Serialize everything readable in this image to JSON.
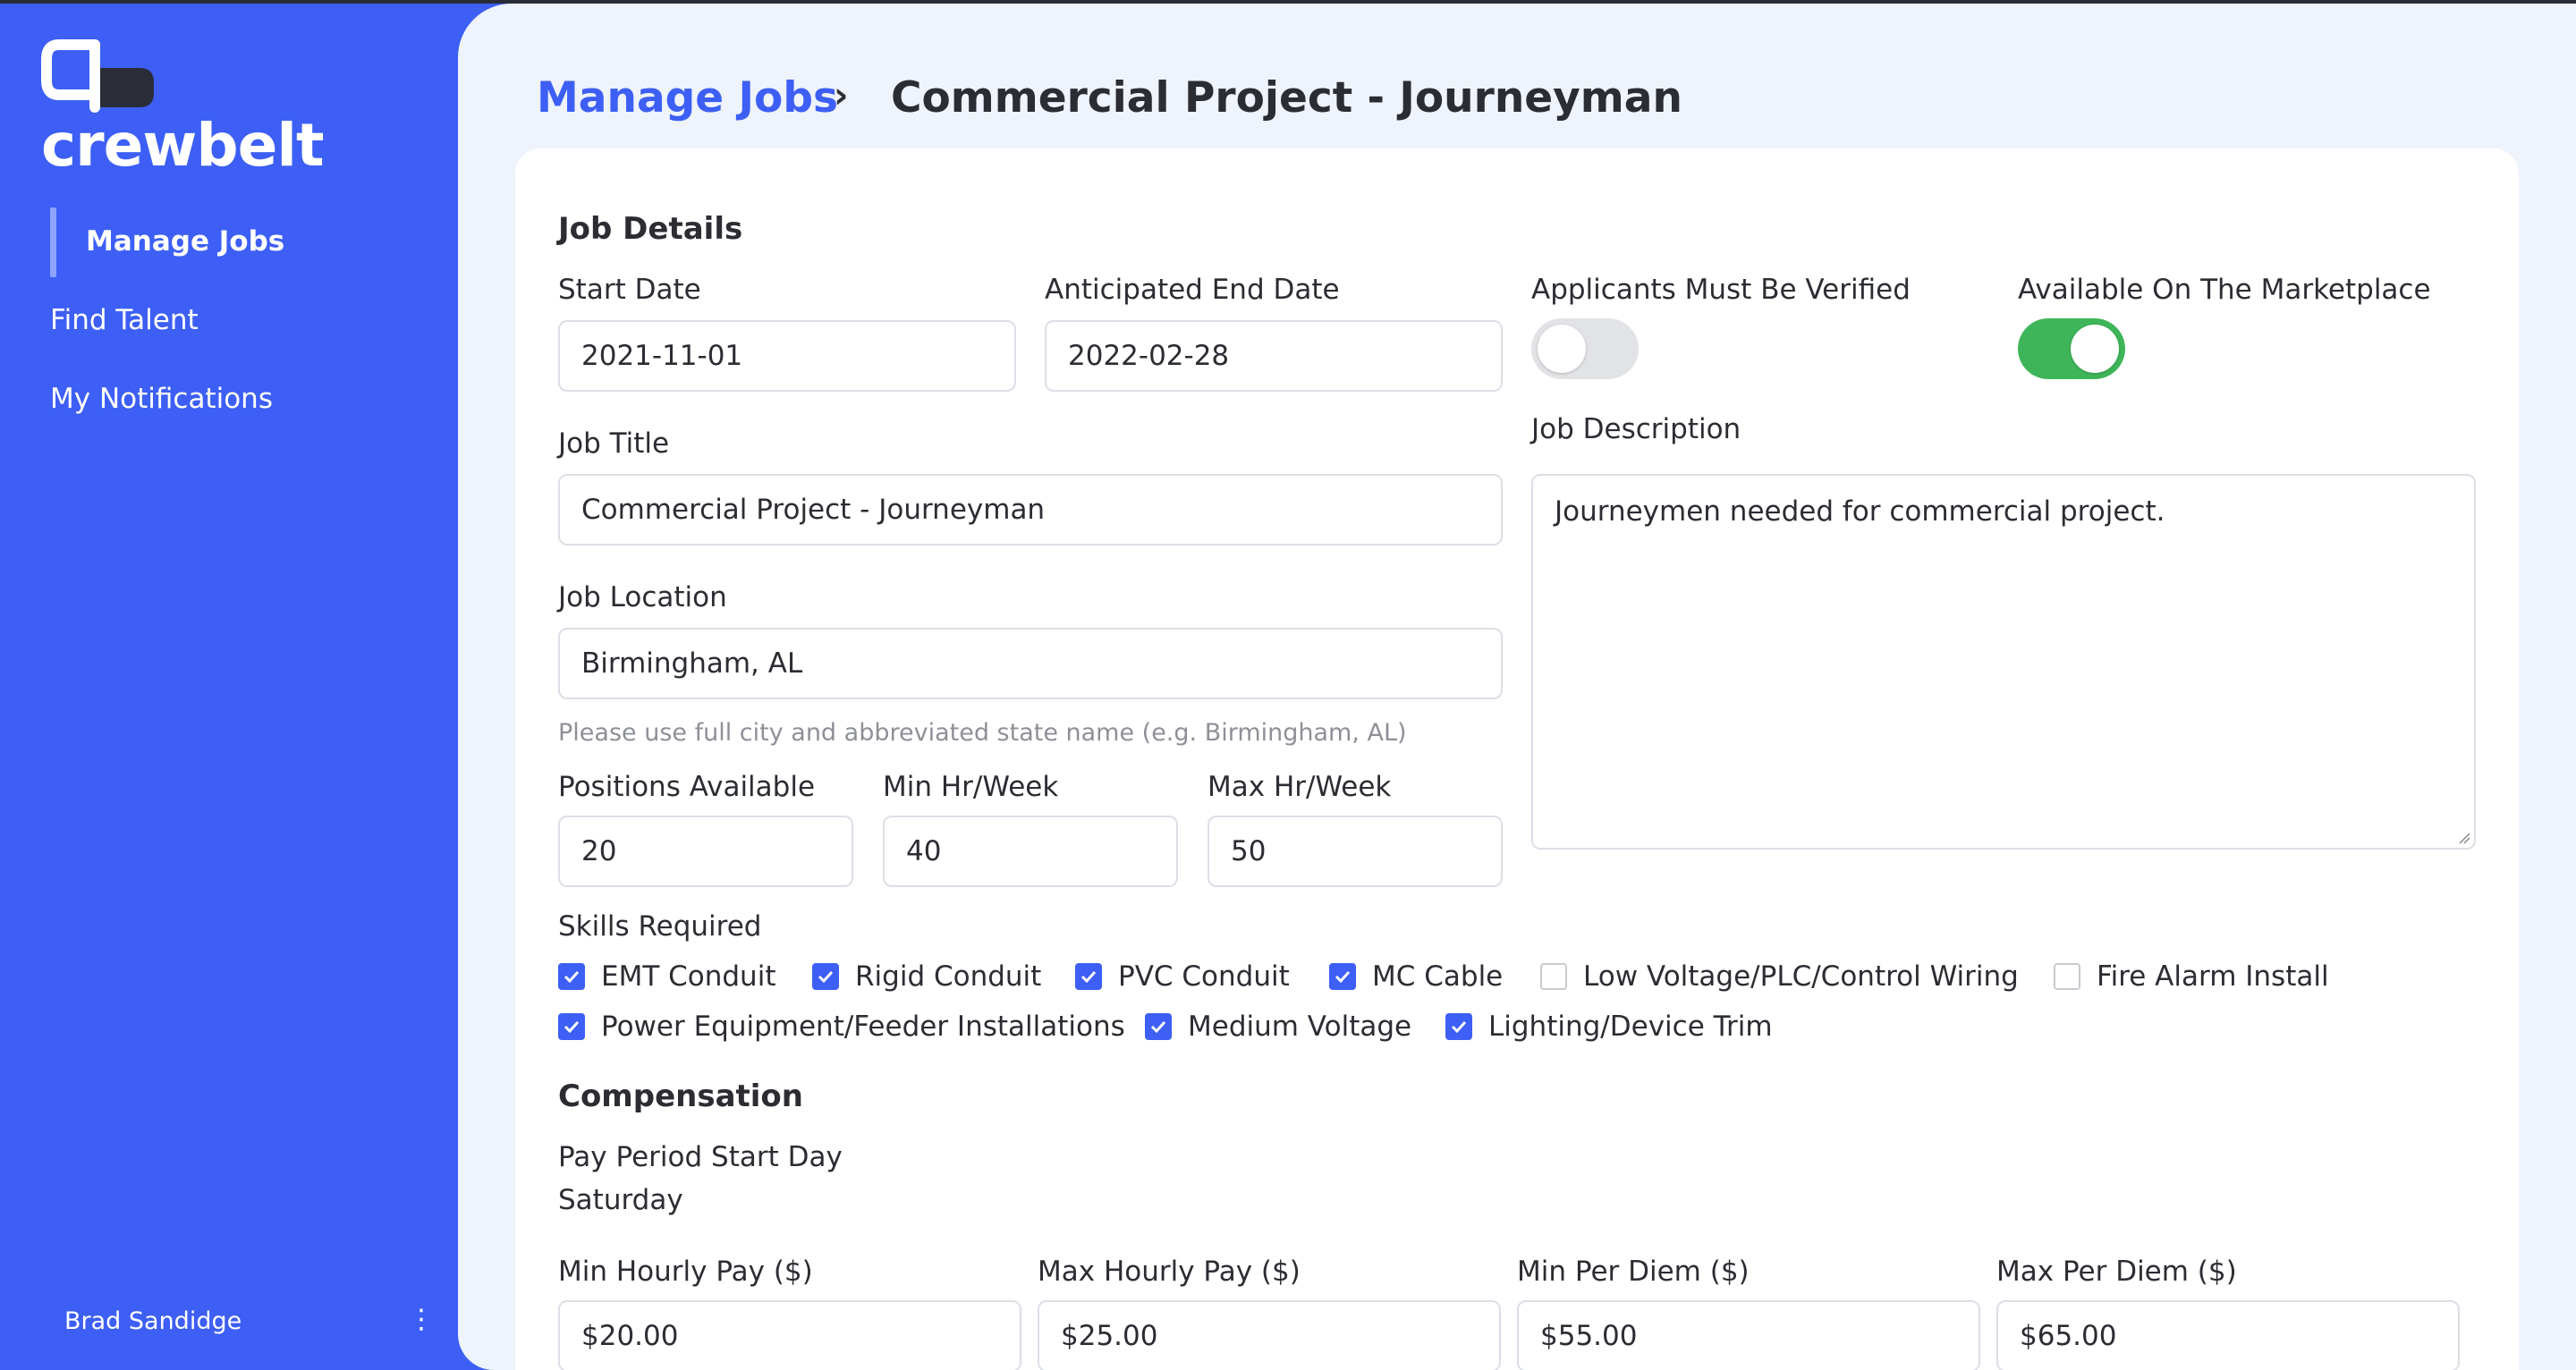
{
  "app": {
    "name": "crewbelt"
  },
  "sidebar": {
    "items": [
      {
        "label": "Manage Jobs",
        "active": true
      },
      {
        "label": "Find Talent",
        "active": false
      },
      {
        "label": "My Notifications",
        "active": false
      }
    ],
    "user_name": "Brad Sandidge",
    "more_icon": "more-vertical-icon"
  },
  "breadcrumb": {
    "parent": "Manage Jobs",
    "separator": "›",
    "current": "Commercial Project - Journeyman"
  },
  "job_details": {
    "title": "Job Details",
    "start_date": {
      "label": "Start Date",
      "value": "2021-11-01"
    },
    "end_date": {
      "label": "Anticipated End Date",
      "value": "2022-02-28"
    },
    "verified": {
      "label": "Applicants Must Be Verified",
      "on": false
    },
    "marketplace": {
      "label": "Available On The Marketplace",
      "on": true
    },
    "job_title": {
      "label": "Job Title",
      "value": "Commercial Project - Journeyman"
    },
    "job_location": {
      "label": "Job Location",
      "value": "Birmingham, AL",
      "hint": "Please use full city and abbreviated state name (e.g. Birmingham, AL)"
    },
    "job_description": {
      "label": "Job Description",
      "value": "Journeymen needed for commercial project."
    },
    "positions": {
      "label": "Positions Available",
      "value": "20"
    },
    "min_hours": {
      "label": "Min Hr/Week",
      "value": "40"
    },
    "max_hours": {
      "label": "Max Hr/Week",
      "value": "50"
    },
    "skills": {
      "label": "Skills Required",
      "items": [
        {
          "label": "EMT Conduit",
          "checked": true
        },
        {
          "label": "Rigid Conduit",
          "checked": true
        },
        {
          "label": "PVC Conduit",
          "checked": true
        },
        {
          "label": "MC Cable",
          "checked": true
        },
        {
          "label": "Low Voltage/PLC/Control Wiring",
          "checked": false
        },
        {
          "label": "Fire Alarm Install",
          "checked": false
        },
        {
          "label": "Power Equipment/Feeder Installations",
          "checked": true
        },
        {
          "label": "Medium Voltage",
          "checked": true
        },
        {
          "label": "Lighting/Device Trim",
          "checked": true
        }
      ]
    }
  },
  "compensation": {
    "title": "Compensation",
    "pay_period": {
      "label": "Pay Period Start Day",
      "value": "Saturday"
    },
    "min_hourly": {
      "label": "Min Hourly Pay ($)",
      "value": "$20.00"
    },
    "max_hourly": {
      "label": "Max Hourly Pay ($)",
      "value": "$25.00"
    },
    "min_per_diem": {
      "label": "Min Per Diem ($)",
      "value": "$55.00"
    },
    "max_per_diem": {
      "label": "Max Per Diem ($)",
      "value": "$65.00"
    }
  },
  "colors": {
    "brand": "#3d5ff5",
    "toggle_on": "#3fb559",
    "background": "#eef3fc"
  }
}
